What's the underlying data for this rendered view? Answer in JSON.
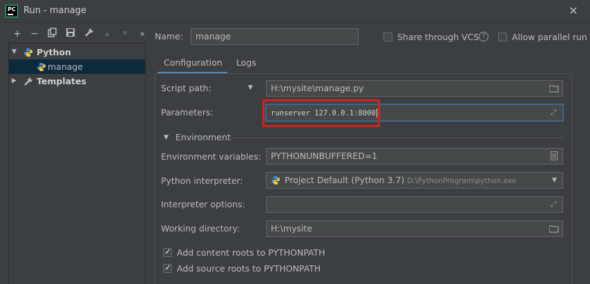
{
  "window": {
    "title": "Run - manage",
    "logo_text": "PC"
  },
  "toolbar": {
    "add": "+",
    "remove": "−",
    "copy": "⧉",
    "save": "💾",
    "wrench": "🔧",
    "up": "▲",
    "down": "▼",
    "more": "»"
  },
  "tree": {
    "python_label": "Python",
    "manage_label": "manage",
    "templates_label": "Templates"
  },
  "config": {
    "name_label": "Name:",
    "name_value": "manage",
    "share_vcs_label": "Share through VCS",
    "allow_parallel_label": "Allow parallel run",
    "tabs": [
      "Configuration",
      "Logs"
    ],
    "script_path_label": "Script path:",
    "script_path_value": "H:\\mysite\\manage.py",
    "parameters_label": "Parameters:",
    "parameters_value": "runserver 127.0.0.1:8000",
    "environment_section": "Environment",
    "env_vars_label": "Environment variables:",
    "env_vars_value": "PYTHONUNBUFFERED=1",
    "interpreter_label": "Python interpreter:",
    "interpreter_value": "Project Default (Python 3.7)",
    "interpreter_path": "D:\\PythonProgram\\python.exe",
    "interp_options_label": "Interpreter options:",
    "interp_options_value": "",
    "working_dir_label": "Working directory:",
    "working_dir_value": "H:\\mysite",
    "add_content_roots_label": "Add content roots to PYTHONPATH",
    "add_source_roots_label": "Add source roots to PYTHONPATH"
  },
  "colors": {
    "accent": "#4a88c7",
    "highlight_box": "#d9201c",
    "selection": "#0d293e"
  }
}
